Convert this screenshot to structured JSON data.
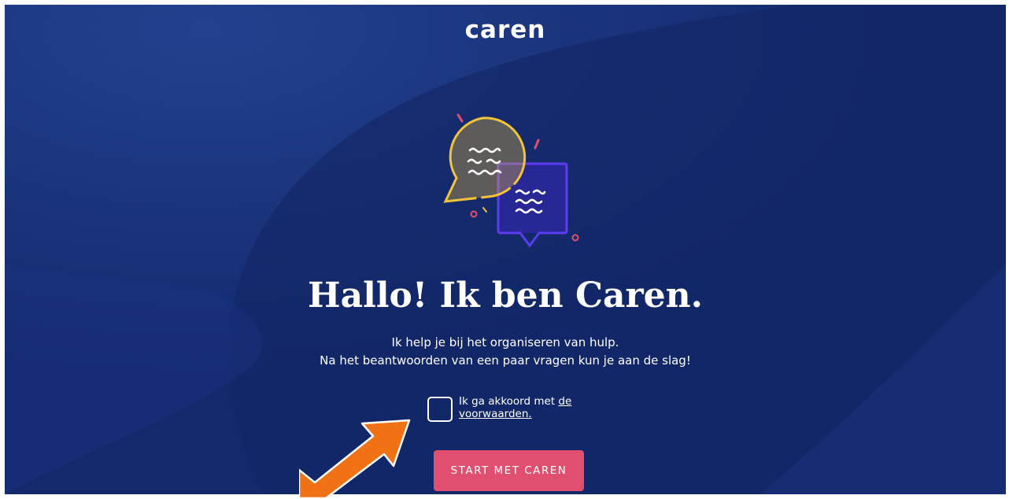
{
  "brand": {
    "logo_text": "caren"
  },
  "hero": {
    "headline": "Hallo! Ik ben Caren.",
    "intro_line1": "Ik help je bij het organiseren van hulp.",
    "intro_line2": "Na het beantwoorden van een paar vragen kun je aan de slag!"
  },
  "consent": {
    "label": "Ik ga akkoord met ",
    "link_text": "de voorwaarden.",
    "checked": false
  },
  "start_button": {
    "label": "START MET CAREN"
  },
  "colors": {
    "background": "#13296c",
    "button": "#e04f6f",
    "bubble_yellow": "#f2c43a",
    "bubble_purple": "#5b3df0",
    "annotation_arrow": "#f07214"
  },
  "icons": {
    "illustration": "chat-bubbles-illustration",
    "annotation": "orange-arrow-annotation"
  }
}
